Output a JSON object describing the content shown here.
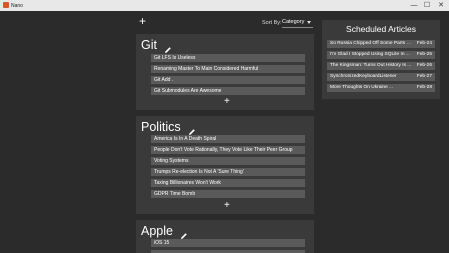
{
  "window": {
    "title": "Nano",
    "minimize": "—",
    "maximize": "☐",
    "close": "✕"
  },
  "toolbar": {
    "add_label": "+",
    "sort_by_label": "Sort By:",
    "sort_value": "Category"
  },
  "categories": [
    {
      "title": "Git",
      "items": [
        "Git LFS Is Useless",
        "Renaming Master To Main Considered Harmful",
        "Git Add .",
        "Git Submodules Are Awesome"
      ],
      "add_label": "+"
    },
    {
      "title": "Politics",
      "items": [
        "America Is In A Death Spiral",
        "People Don't Vote Rationally, They Vote Like Their Peer Group",
        "Voting Systems",
        "Trumps Re-election Is Not A 'Sure Thing'",
        "Taxing Billionaires Won't Work",
        "GDPR Time Bomb"
      ],
      "add_label": "+"
    },
    {
      "title": "Apple",
      "items": [
        "iOS 15"
      ],
      "add_label": "+"
    }
  ],
  "scheduled": {
    "title": "Scheduled Articles",
    "items": [
      {
        "title": "So Russia Chipped Off Some Parts O...",
        "date": "Feb-24"
      },
      {
        "title": "I'm Glad I Stopped Using SQLite In ...",
        "date": "Feb-25"
      },
      {
        "title": "The Kingsman: Turns Out History Is ...",
        "date": "Feb-26"
      },
      {
        "title": "SynchronizedKeyboardListener",
        "date": "Feb-27"
      },
      {
        "title": "More Thoughts On Ukraine ...",
        "date": "Feb-28"
      }
    ]
  },
  "colors": {
    "background": "#2b2b2b",
    "card": "#3a3a3a",
    "item": "#5a5a5a",
    "titlebar": "#e8e8e8"
  }
}
